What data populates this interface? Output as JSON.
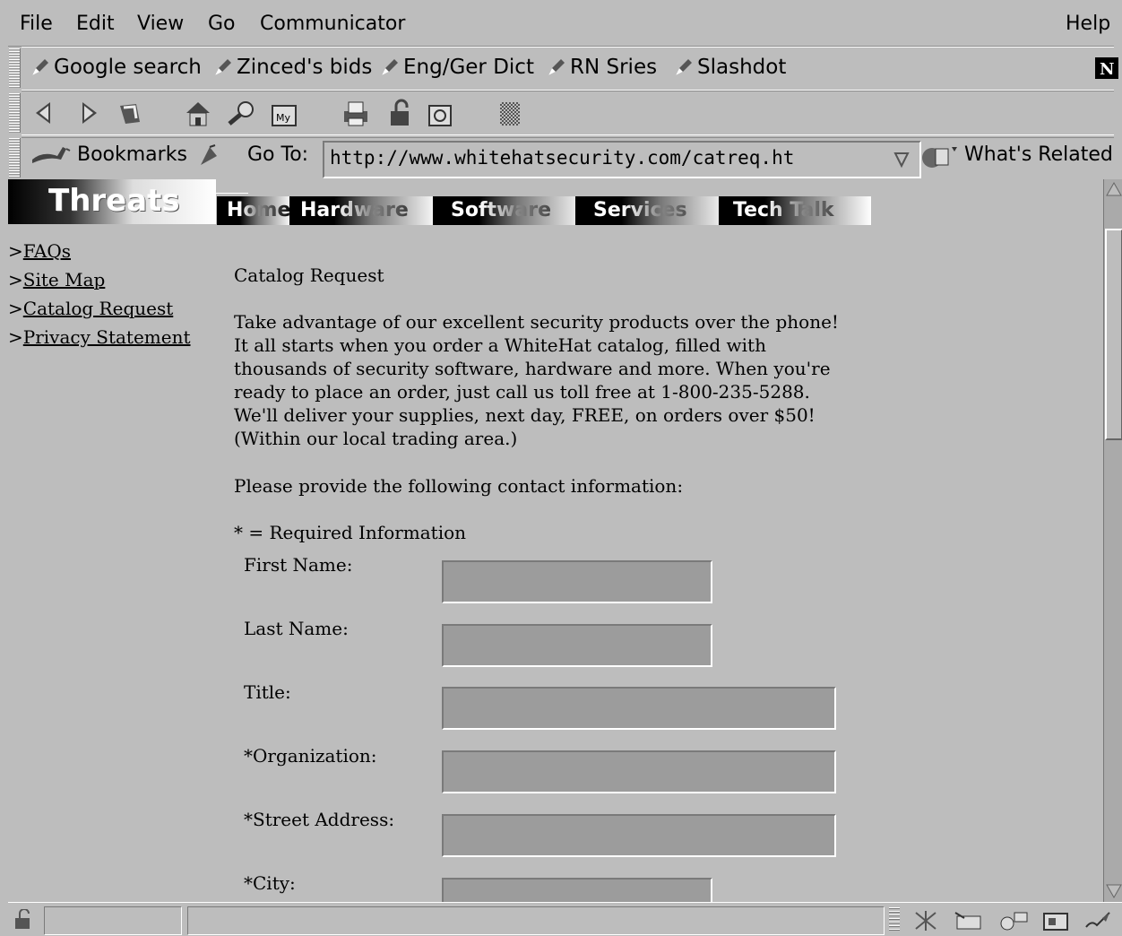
{
  "menu": {
    "file": "File",
    "edit": "Edit",
    "view": "View",
    "go": "Go",
    "communicator": "Communicator",
    "help": "Help"
  },
  "personal_toolbar": [
    "Google search",
    "Zinced's bids",
    "Eng/Ger Dict",
    "RN Sries",
    "Slashdot"
  ],
  "location_bar": {
    "bookmarks_label": "Bookmarks",
    "goto_label": "Go To:",
    "url": "http://www.whitehatsecurity.com/catreq.ht",
    "related_label": "What's Related"
  },
  "site": {
    "logo_text": "Threats",
    "nav_tabs": [
      "Home",
      "Hardware",
      "Software",
      "Services",
      "Tech Talk"
    ],
    "side_links": [
      "FAQs",
      "Site Map",
      "Catalog Request",
      "Privacy Statement"
    ],
    "heading": "Catalog Request",
    "intro": "Take advantage of our excellent security products over the phone! It all starts when you order a WhiteHat catalog, filled with thousands of security software, hardware and more. When you're ready to place an order, just call us toll free at 1-800-235-5288. We'll deliver your supplies, next day, FREE, on orders over $50! (Within our local trading area.)",
    "contact_prompt": "Please provide the following contact information:",
    "required_note": "* = Required Information",
    "fields": [
      "First Name:",
      "Last Name:",
      "Title:",
      "*Organization:",
      "*Street Address:",
      "*City:"
    ]
  }
}
